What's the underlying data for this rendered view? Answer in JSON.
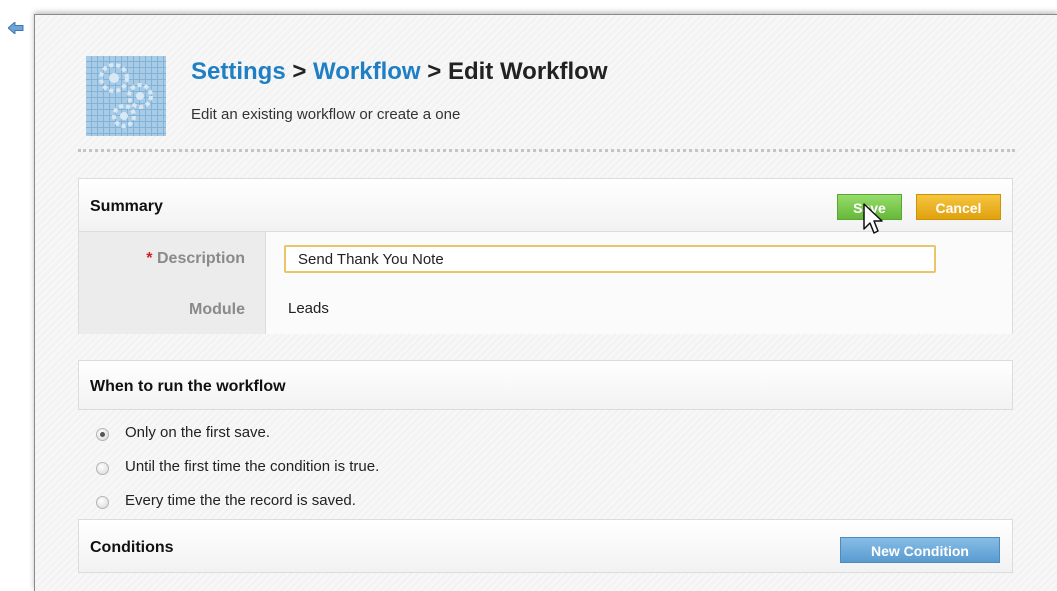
{
  "nav": {
    "back_icon": "back-arrow-icon"
  },
  "header": {
    "icon": "workflow-gears-icon",
    "breadcrumb": [
      {
        "label": "Settings",
        "link": true
      },
      {
        "label": " > ",
        "link": false
      },
      {
        "label": "Workflow",
        "link": true
      },
      {
        "label": " > Edit Workflow",
        "link": false
      }
    ],
    "subtitle": "Edit an existing workflow or create a one"
  },
  "summary": {
    "title": "Summary",
    "save_label": "Save",
    "cancel_label": "Cancel",
    "fields": {
      "description": {
        "required_mark": "*",
        "label": "Description",
        "value": "Send Thank You Note"
      },
      "module": {
        "label": "Module",
        "value": "Leads"
      }
    }
  },
  "run_section": {
    "title": "When to run the workflow",
    "options": [
      {
        "label": "Only on the first save.",
        "checked": true
      },
      {
        "label": "Until the first time the condition is true.",
        "checked": false
      },
      {
        "label": "Every time the the record is saved.",
        "checked": false
      }
    ]
  },
  "conditions": {
    "title": "Conditions",
    "new_label": "New Condition"
  },
  "colors": {
    "link": "#1f7fc4",
    "save_button": "#66b83a",
    "cancel_button": "#e0a10d",
    "new_condition_button": "#5a9bd0",
    "required": "#d01f1f",
    "input_focus_border": "#e8c46a"
  }
}
